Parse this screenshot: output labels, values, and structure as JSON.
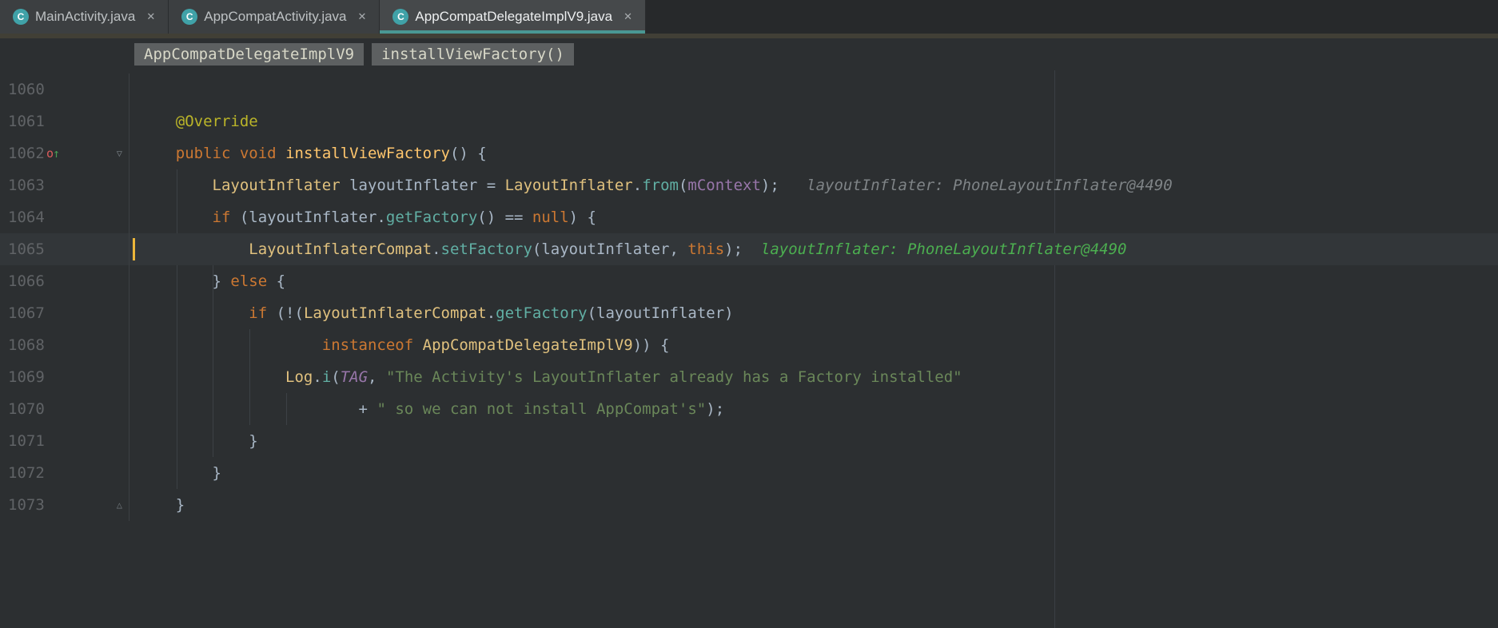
{
  "tabs": [
    {
      "label": "MainActivity.java",
      "active": false
    },
    {
      "label": "AppCompatActivity.java",
      "active": false
    },
    {
      "label": "AppCompatDelegateImplV9.java",
      "active": true
    }
  ],
  "icons": {
    "class_badge": "C",
    "close": "✕",
    "fold_start": "▽",
    "fold_end": "△",
    "override_o": "o",
    "override_arrow": "↑"
  },
  "breadcrumbs": [
    {
      "label": "AppCompatDelegateImplV9"
    },
    {
      "label": "installViewFactory()"
    }
  ],
  "editor": {
    "debug_hint_value": "layoutInflater: PhoneLayoutInflater@4490",
    "lines": [
      {
        "num": "1060",
        "tokens": []
      },
      {
        "num": "1061",
        "tokens": [
          {
            "t": "    ",
            "c": "plain"
          },
          {
            "t": "@Override",
            "c": "annotation"
          }
        ]
      },
      {
        "num": "1062",
        "marker": "override",
        "fold": "start",
        "tokens": [
          {
            "t": "    ",
            "c": "plain"
          },
          {
            "t": "public",
            "c": "keyword"
          },
          {
            "t": " ",
            "c": "plain"
          },
          {
            "t": "void",
            "c": "keyword"
          },
          {
            "t": " ",
            "c": "plain"
          },
          {
            "t": "installViewFactory",
            "c": "methodDecl"
          },
          {
            "t": "() {",
            "c": "plain"
          }
        ]
      },
      {
        "num": "1063",
        "tokens": [
          {
            "t": "        ",
            "c": "plain"
          },
          {
            "t": "LayoutInflater",
            "c": "classRef"
          },
          {
            "t": " layoutInflater = ",
            "c": "plain"
          },
          {
            "t": "LayoutInflater",
            "c": "classRef"
          },
          {
            "t": ".",
            "c": "plain"
          },
          {
            "t": "from",
            "c": "methodCall"
          },
          {
            "t": "(",
            "c": "plain"
          },
          {
            "t": "mContext",
            "c": "field"
          },
          {
            "t": ");",
            "c": "plain"
          },
          {
            "t": "   ",
            "c": "plain"
          },
          {
            "t": "layoutInflater: PhoneLayoutInflater@4490",
            "c": "hintGray"
          }
        ]
      },
      {
        "num": "1064",
        "tokens": [
          {
            "t": "        ",
            "c": "plain"
          },
          {
            "t": "if",
            "c": "keyword"
          },
          {
            "t": " (layoutInflater.",
            "c": "plain"
          },
          {
            "t": "getFactory",
            "c": "methodCall"
          },
          {
            "t": "() == ",
            "c": "plain"
          },
          {
            "t": "null",
            "c": "keyword"
          },
          {
            "t": ") {",
            "c": "plain"
          }
        ]
      },
      {
        "num": "1065",
        "exec": true,
        "tokens": [
          {
            "t": "            ",
            "c": "plain"
          },
          {
            "t": "LayoutInflaterCompat",
            "c": "classRef"
          },
          {
            "t": ".",
            "c": "plain"
          },
          {
            "t": "setFactory",
            "c": "methodCall"
          },
          {
            "t": "(layoutInflater, ",
            "c": "plain"
          },
          {
            "t": "this",
            "c": "keyword"
          },
          {
            "t": ");",
            "c": "plain"
          },
          {
            "t": "  ",
            "c": "plain"
          },
          {
            "t": "layoutInflater: PhoneLayoutInflater@4490",
            "c": "hintGreen"
          }
        ]
      },
      {
        "num": "1066",
        "tokens": [
          {
            "t": "        ",
            "c": "plain"
          },
          {
            "t": "} ",
            "c": "plain"
          },
          {
            "t": "else",
            "c": "keyword"
          },
          {
            "t": " {",
            "c": "plain"
          }
        ]
      },
      {
        "num": "1067",
        "tokens": [
          {
            "t": "            ",
            "c": "plain"
          },
          {
            "t": "if",
            "c": "keyword"
          },
          {
            "t": " (!(",
            "c": "plain"
          },
          {
            "t": "LayoutInflaterCompat",
            "c": "classRef"
          },
          {
            "t": ".",
            "c": "plain"
          },
          {
            "t": "getFactory",
            "c": "methodCall"
          },
          {
            "t": "(layoutInflater)",
            "c": "plain"
          }
        ]
      },
      {
        "num": "1068",
        "tokens": [
          {
            "t": "                    ",
            "c": "plain"
          },
          {
            "t": "instanceof",
            "c": "keyword"
          },
          {
            "t": " ",
            "c": "plain"
          },
          {
            "t": "AppCompatDelegateImplV9",
            "c": "classRef"
          },
          {
            "t": ")) {",
            "c": "plain"
          }
        ]
      },
      {
        "num": "1069",
        "tokens": [
          {
            "t": "                ",
            "c": "plain"
          },
          {
            "t": "Log",
            "c": "classRef"
          },
          {
            "t": ".",
            "c": "plain"
          },
          {
            "t": "i",
            "c": "methodCall"
          },
          {
            "t": "(",
            "c": "plain"
          },
          {
            "t": "TAG",
            "c": "constant"
          },
          {
            "t": ", ",
            "c": "plain"
          },
          {
            "t": "\"The Activity's LayoutInflater already has a Factory installed\"",
            "c": "string"
          }
        ]
      },
      {
        "num": "1070",
        "tokens": [
          {
            "t": "                        ",
            "c": "plain"
          },
          {
            "t": "+ ",
            "c": "plain"
          },
          {
            "t": "\" so we can not install AppCompat's\"",
            "c": "string"
          },
          {
            "t": ");",
            "c": "plain"
          }
        ]
      },
      {
        "num": "1071",
        "tokens": [
          {
            "t": "            ",
            "c": "plain"
          },
          {
            "t": "}",
            "c": "plain"
          }
        ]
      },
      {
        "num": "1072",
        "tokens": [
          {
            "t": "        ",
            "c": "plain"
          },
          {
            "t": "}",
            "c": "plain"
          }
        ]
      },
      {
        "num": "1073",
        "fold": "end",
        "tokens": [
          {
            "t": "    ",
            "c": "plain"
          },
          {
            "t": "}",
            "c": "plain"
          }
        ]
      }
    ]
  },
  "colors": {
    "editorBg": "#2C2F31",
    "tabStripBg": "#27292B",
    "tabBg": "#3C3F41",
    "tabActiveBg": "#46494B",
    "tabUnderline": "#4A9793",
    "classIconBg": "#40A2A8",
    "bandColor": "#413F36",
    "crumbBg": "#5D6061",
    "crumbText": "#D8D8C8",
    "lineNum": "#606366",
    "execBg": "#323639",
    "caretBar": "#ECB63A",
    "keyword": "#CC7832",
    "classRef": "#E0C17E",
    "methodCall": "#61AFA4",
    "methodDecl": "#FFC66D",
    "field": "#9876AA",
    "string": "#6A8759",
    "annotation": "#BBB529",
    "hintGray": "#7F8487",
    "hintGreen": "#4CAF50",
    "plain": "#A9B7C6"
  }
}
